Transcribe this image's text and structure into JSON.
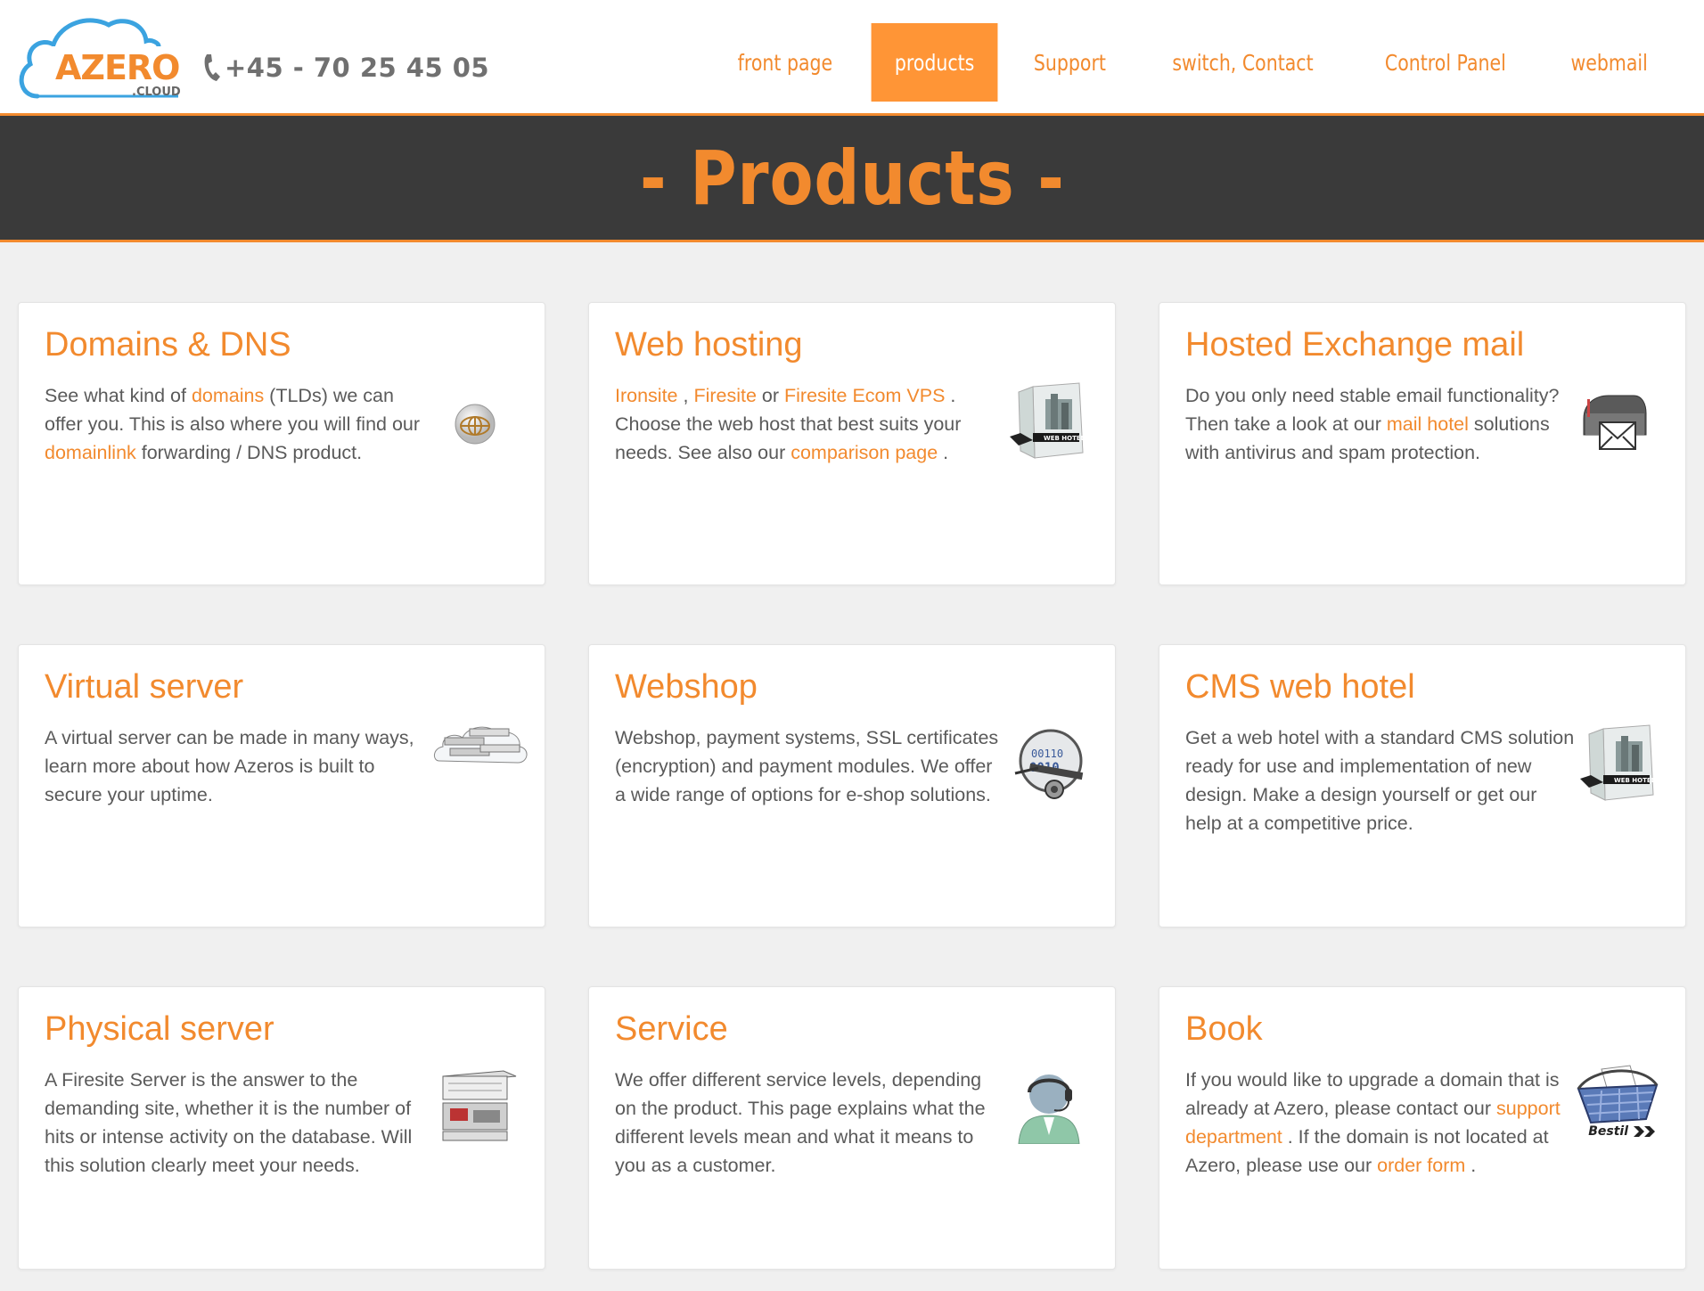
{
  "header": {
    "logo_text": "AZERO",
    "logo_sub": ".CLOUD",
    "phone": "+45 - 70 25 45 05",
    "nav": [
      {
        "label": "front page",
        "active": false
      },
      {
        "label": "products",
        "active": true
      },
      {
        "label": "Support",
        "active": false
      },
      {
        "label": "switch, Contact",
        "active": false
      },
      {
        "label": "Control Panel",
        "active": false
      },
      {
        "label": "webmail",
        "active": false
      }
    ]
  },
  "banner": {
    "title": "- Products -"
  },
  "cards": [
    {
      "title": "Domains & DNS",
      "icon": "globe-icon",
      "body": [
        {
          "t": "See what kind of "
        },
        {
          "t": "domains",
          "link": true
        },
        {
          "t": " (TLDs) we can offer you. This is also where you will find our "
        },
        {
          "t": "domainlink",
          "link": true
        },
        {
          "t": " forwarding / DNS product."
        }
      ]
    },
    {
      "title": "Web hosting",
      "icon": "webhotel-box-icon",
      "body": [
        {
          "t": "Ironsite",
          "link": true
        },
        {
          "t": " , "
        },
        {
          "t": "Firesite",
          "link": true
        },
        {
          "t": " or "
        },
        {
          "t": "Firesite Ecom VPS",
          "link": true
        },
        {
          "t": " . Choose the web host that best suits your needs. See also our "
        },
        {
          "t": "comparison page",
          "link": true
        },
        {
          "t": " ."
        }
      ]
    },
    {
      "title": "Hosted Exchange mail",
      "icon": "mailbox-icon",
      "body": [
        {
          "t": "Do you only need stable email functionality? Then take a look at our "
        },
        {
          "t": "mail hotel",
          "link": true
        },
        {
          "t": " solutions with antivirus and spam protection."
        }
      ]
    },
    {
      "title": "Virtual server",
      "icon": "cloud-servers-icon",
      "body": [
        {
          "t": "A virtual server can be made in many ways, learn more about how Azeros is built to secure your uptime."
        }
      ]
    },
    {
      "title": "Webshop",
      "icon": "secure-lock-icon",
      "body": [
        {
          "t": "Webshop, payment systems, SSL certificates (encryption) and payment modules. We offer a wide range of options for e-shop solutions."
        }
      ]
    },
    {
      "title": "CMS web hotel",
      "icon": "webhotel-box-icon",
      "body": [
        {
          "t": "Get a web hotel with a standard CMS solution ready for use and implementation of new design. Make a design yourself or get our help at a competitive price."
        }
      ]
    },
    {
      "title": "Physical server",
      "icon": "rack-server-icon",
      "body": [
        {
          "t": "A Firesite Server is the answer to the demanding site, whether it is the number of hits or intense activity on the database. Will this solution clearly meet your needs."
        }
      ]
    },
    {
      "title": "Service",
      "icon": "support-agent-icon",
      "body": [
        {
          "t": "We offer different service levels, depending on the product. This page explains what the different levels mean and what it means to you as a customer."
        }
      ]
    },
    {
      "title": "Book",
      "icon": "shopping-basket-icon",
      "icon_caption": "Bestil",
      "body": [
        {
          "t": "If you would like to upgrade a domain that is already at Azero, please contact our "
        },
        {
          "t": "support department",
          "link": true
        },
        {
          "t": " . If the domain is not located at Azero, please use our "
        },
        {
          "t": "order form",
          "link": true
        },
        {
          "t": " ."
        }
      ]
    }
  ],
  "colors": {
    "accent": "#f28a2e",
    "nav_active_bg": "#ff9536",
    "banner_bg": "#3a3a3a",
    "page_bg": "#f0f0f0"
  }
}
